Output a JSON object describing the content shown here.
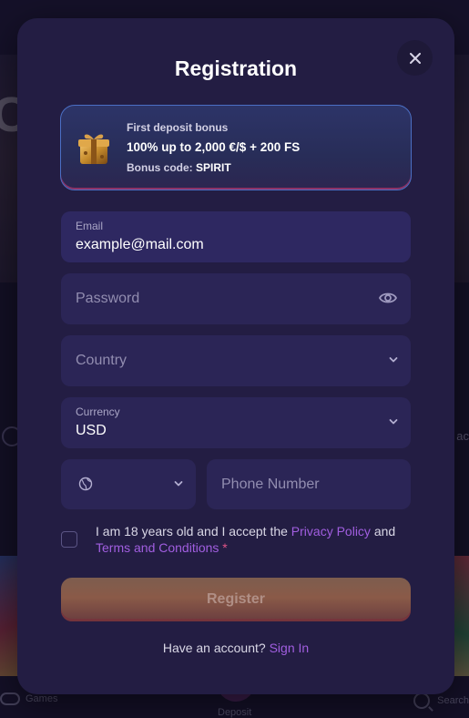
{
  "background": {
    "hero_left_letter": "C",
    "side_label_right": "ac",
    "nav": {
      "games": "Games",
      "deposit": "Deposit",
      "search": "Search"
    }
  },
  "modal": {
    "title": "Registration",
    "close_icon": "close-icon",
    "bonus": {
      "icon": "gift-icon",
      "line1": "First deposit bonus",
      "line2": "100% up to 2,000 €/$ + 200 FS",
      "code_label": "Bonus code: ",
      "code": "SPIRIT"
    },
    "email": {
      "label": "Email",
      "value": "example@mail.com"
    },
    "password": {
      "placeholder": "Password",
      "icon": "eye-icon"
    },
    "country": {
      "placeholder": "Country",
      "icon": "chevron-down-icon"
    },
    "currency": {
      "label": "Currency",
      "value": "USD",
      "icon": "chevron-down-icon"
    },
    "phone": {
      "code_icon": "globe-icon",
      "placeholder": "Phone Number"
    },
    "terms": {
      "text_before": "I am 18 years old and I accept the ",
      "privacy_link": "Privacy Policy",
      "text_mid": " and ",
      "terms_link": "Terms and Conditions",
      "required_mark": " *",
      "checked": false
    },
    "register_label": "Register",
    "have_account_text": "Have an account? ",
    "sign_in_link": "Sign In"
  },
  "colors": {
    "modal_bg": "#231d43",
    "field_bg": "#2b2556",
    "link": "#a15ee0",
    "bonus_border": "#4b6fc4"
  }
}
